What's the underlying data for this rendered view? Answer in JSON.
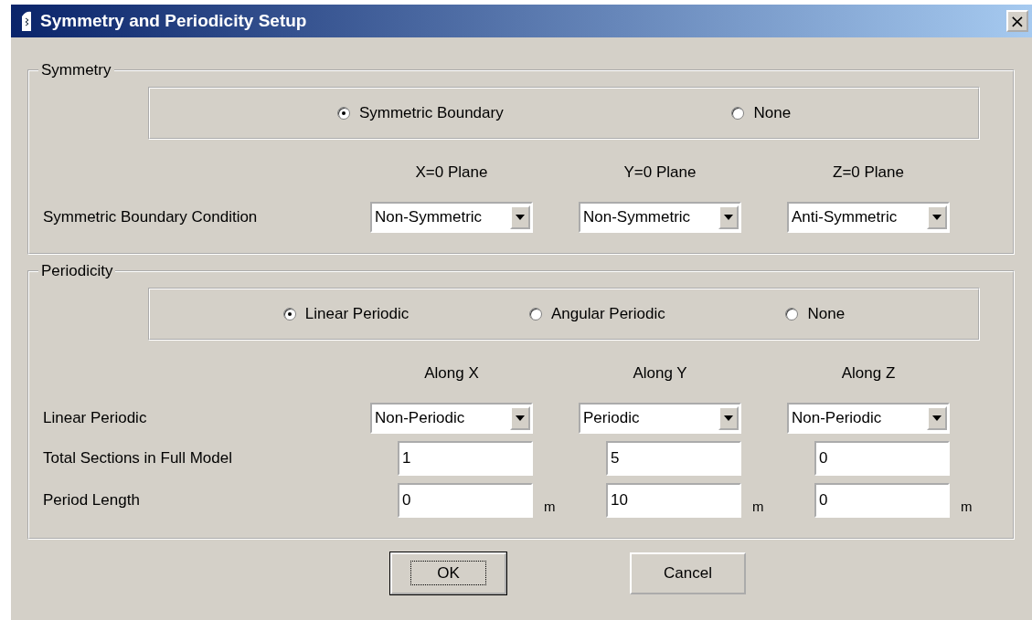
{
  "window": {
    "title": "Symmetry and Periodicity Setup",
    "close": "×"
  },
  "symmetry": {
    "title": "Symmetry",
    "options": [
      {
        "label": "Symmetric Boundary",
        "selected": true
      },
      {
        "label": "None",
        "selected": false
      }
    ],
    "columns": [
      "X=0 Plane",
      "Y=0 Plane",
      "Z=0 Plane"
    ],
    "rows": [
      {
        "kind": "dropdown",
        "label": "Symmetric Boundary Condition",
        "values": [
          "Non-Symmetric",
          "Non-Symmetric",
          "Anti-Symmetric"
        ]
      }
    ]
  },
  "periodicity": {
    "title": "Periodicity",
    "options": [
      {
        "label": "Linear Periodic",
        "selected": true
      },
      {
        "label": "Angular Periodic",
        "selected": false
      },
      {
        "label": "None",
        "selected": false
      }
    ],
    "columns": [
      "Along X",
      "Along Y",
      "Along Z"
    ],
    "rows": [
      {
        "kind": "dropdown",
        "label": "Linear Periodic",
        "values": [
          "Non-Periodic",
          "Periodic",
          "Non-Periodic"
        ]
      },
      {
        "kind": "field",
        "label": "Total Sections in Full Model",
        "values": [
          "1",
          "5",
          "0"
        ]
      },
      {
        "kind": "field",
        "label": "Period Length",
        "values": [
          "0",
          "10",
          "0"
        ],
        "units": [
          "m",
          "m",
          "m"
        ]
      }
    ]
  },
  "buttons": [
    {
      "label": "OK",
      "default": true
    },
    {
      "label": "Cancel",
      "default": false
    }
  ]
}
